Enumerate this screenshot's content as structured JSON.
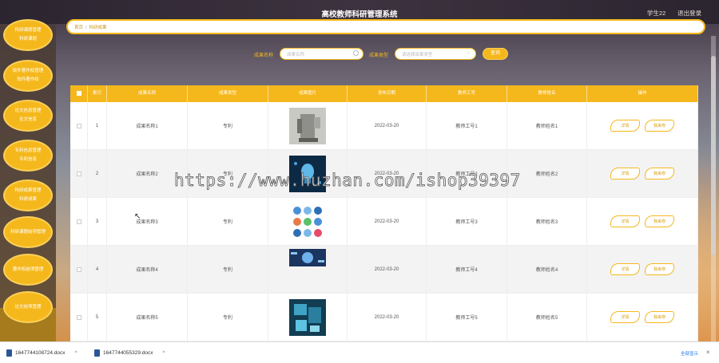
{
  "app": {
    "title": "高校教师科研管理系统",
    "user": "学生22",
    "logout": "退出登录"
  },
  "sidebar": {
    "items": [
      {
        "lines": [
          "科研课题管理",
          "科研课题"
        ]
      },
      {
        "lines": [
          "软件著作权管理",
          "软件著作权"
        ]
      },
      {
        "lines": [
          "论文信息管理",
          "论文信息"
        ]
      },
      {
        "lines": [
          "专利信息管理",
          "专利信息"
        ]
      },
      {
        "lines": [
          "科研成果管理",
          "科研成果"
        ]
      },
      {
        "lines": [
          "科研课题结项管理"
        ]
      },
      {
        "lines": [
          "著作权结项管理"
        ]
      },
      {
        "lines": [
          "论文结项管理"
        ]
      }
    ]
  },
  "breadcrumb": {
    "home": "首页",
    "sep": "/",
    "current": "科研成果"
  },
  "search": {
    "name_label": "成果名称",
    "name_placeholder": "成果名称",
    "type_label": "成果类型",
    "type_placeholder": "请选择成果类型",
    "query_button": "查询"
  },
  "table": {
    "headers": [
      "索引",
      "成果名称",
      "成果类型",
      "成果图片",
      "发布日期",
      "教师工号",
      "教师姓名",
      "操作"
    ],
    "rows": [
      {
        "index": "1",
        "name": "成果名称1",
        "type": "专利",
        "date": "2022-03-20",
        "teacher_id": "教师工号1",
        "teacher_name": "教师姓名1"
      },
      {
        "index": "2",
        "name": "成果名称2",
        "type": "专利",
        "date": "2022-03-20",
        "teacher_id": "教师工号2",
        "teacher_name": "教师姓名2"
      },
      {
        "index": "3",
        "name": "成果名称3",
        "type": "专利",
        "date": "2022-03-20",
        "teacher_id": "教师工号3",
        "teacher_name": "教师姓名3"
      },
      {
        "index": "4",
        "name": "成果名称4",
        "type": "专利",
        "date": "2022-03-20",
        "teacher_id": "教师工号4",
        "teacher_name": "教师姓名4"
      },
      {
        "index": "5",
        "name": "成果名称5",
        "type": "专利",
        "date": "2022-03-20",
        "teacher_id": "教师工号5",
        "teacher_name": "教师姓名5"
      }
    ],
    "detail_button": "详情",
    "finish_button": "我来修"
  },
  "watermark": "https://www.huzhan.com/ishop39397",
  "downloads": {
    "files": [
      "1647744108724.docx",
      "1647744055329.docx"
    ],
    "show_all": "全部显示"
  },
  "colors": {
    "accent": "#f5b81c",
    "topbar": "#2b2530"
  }
}
